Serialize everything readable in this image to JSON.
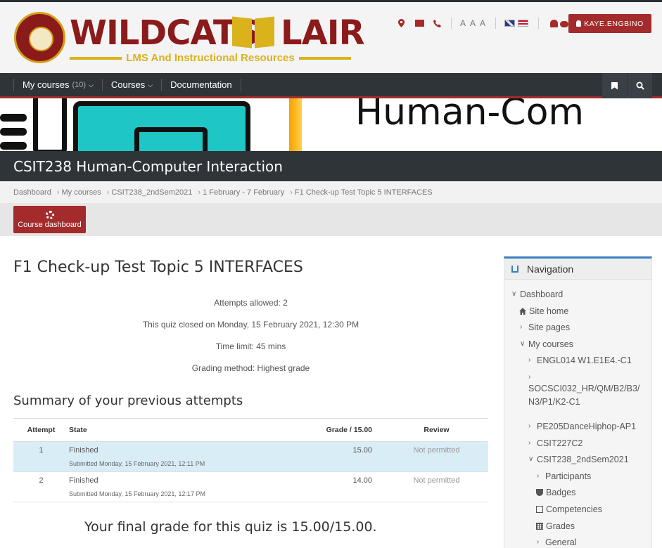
{
  "header": {
    "logo_title": "WILDCATS",
    "logo_title2": "LAIR",
    "logo_subtitle": "LMS And Instructional Resources",
    "font_sizes_label": "A A A",
    "user_button": "KAYE.ENGBINO"
  },
  "nav": {
    "my_courses": "My courses",
    "my_courses_count": "(10)",
    "courses": "Courses",
    "documentation": "Documentation"
  },
  "banner": {
    "text": "Human-Com"
  },
  "course_title": "CSIT238 Human-Computer Interaction",
  "breadcrumb": [
    "Dashboard",
    "My courses",
    "CSIT238_2ndSem2021",
    "1 February - 7 February",
    "F1 Check-up Test Topic 5 INTERFACES"
  ],
  "course_dashboard_label": "Course dashboard",
  "quiz": {
    "title": "F1 Check-up Test Topic 5 INTERFACES",
    "attempts_allowed": "Attempts allowed: 2",
    "closed": "This quiz closed on Monday, 15 February 2021, 12:30 PM",
    "time_limit": "Time limit: 45 mins",
    "grading": "Grading method: Highest grade",
    "summary_title": "Summary of your previous attempts",
    "columns": [
      "Attempt",
      "State",
      "Grade / 15.00",
      "Review"
    ],
    "attempts": [
      {
        "num": "1",
        "state": "Finished",
        "submitted": "Submitted Monday, 15 February 2021, 12:11 PM",
        "grade": "15.00",
        "review": "Not permitted"
      },
      {
        "num": "2",
        "state": "Finished",
        "submitted": "Submitted Monday, 15 February 2021, 12:17 PM",
        "grade": "14.00",
        "review": "Not permitted"
      }
    ],
    "final_grade": "Your final grade for this quiz is 15.00/15.00."
  },
  "sidebar": {
    "title": "Navigation",
    "items": [
      {
        "label": "Dashboard"
      },
      {
        "label": "Site home"
      },
      {
        "label": "Site pages"
      },
      {
        "label": "My courses"
      },
      {
        "label": "ENGL014 W1.E1E4.-C1"
      },
      {
        "label": "SOCSCI032_HR/QM/B2/B3/N3/P1/K2-C1"
      },
      {
        "label": "PE205DanceHiphop-AP1"
      },
      {
        "label": "CSIT227C2"
      },
      {
        "label": "CSIT238_2ndSem2021"
      },
      {
        "label": "Participants"
      },
      {
        "label": "Badges"
      },
      {
        "label": "Competencies"
      },
      {
        "label": "Grades"
      },
      {
        "label": "General"
      }
    ]
  },
  "colors": {
    "brand_red": "#a32b2b",
    "dark_bar": "#2f3439",
    "logo_gold": "#d9b21c",
    "highlight_row": "#d9edf7",
    "accent_blue": "#3a7fc1"
  }
}
